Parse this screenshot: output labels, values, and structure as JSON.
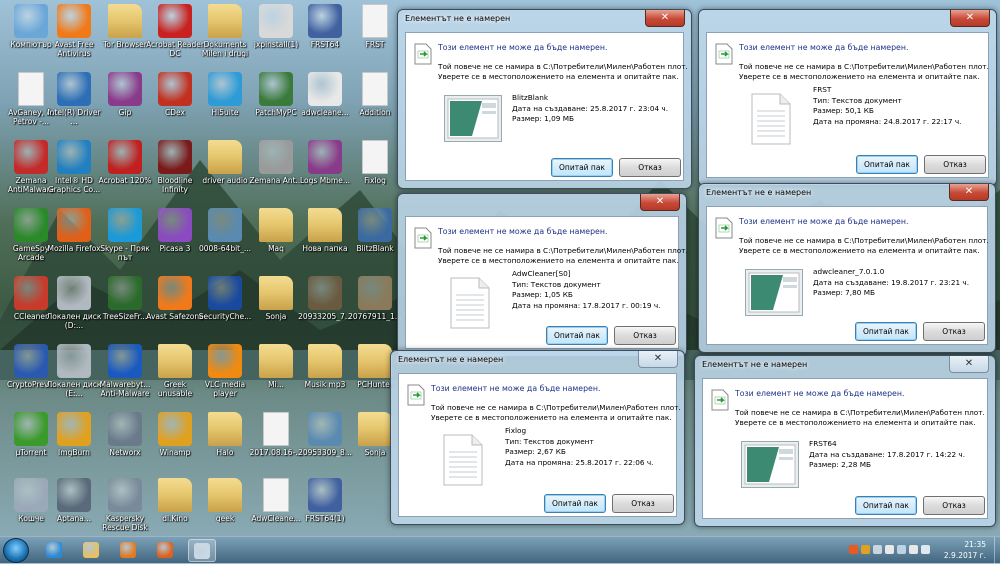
{
  "desktop": {
    "icons": [
      {
        "label": "Компютър",
        "icon": "computer-icon",
        "color": "#6aa7d8"
      },
      {
        "label": "Avast Free Antivirus",
        "icon": "avast-icon",
        "color": "#f07a1a"
      },
      {
        "label": "Tor Browser",
        "icon": "folder-icon",
        "color": "#e7c870"
      },
      {
        "label": "Acrobat Reader DC",
        "icon": "acrobat-icon",
        "color": "#c8211f"
      },
      {
        "label": "Dokuments Milen i drugi",
        "icon": "folder-icon",
        "color": "#e7c870"
      },
      {
        "label": "jxpinstall(1)",
        "icon": "java-installer-icon",
        "color": "#d9d9d9"
      },
      {
        "label": "FRST64",
        "icon": "frst-icon",
        "color": "#4060a0"
      },
      {
        "label": "FRST",
        "icon": "document-icon",
        "color": "#f4f4f4"
      },
      {
        "label": "AvGaney, A. Petrov -...",
        "icon": "document-icon",
        "color": "#f4f4f4"
      },
      {
        "label": "Intel(R) Driver ...",
        "icon": "intel-icon",
        "color": "#2d6fb6"
      },
      {
        "label": "Gip",
        "icon": "winrar-icon",
        "color": "#8a3a8a"
      },
      {
        "label": "CDex",
        "icon": "cdex-icon",
        "color": "#c23020"
      },
      {
        "label": "Hi5uite",
        "icon": "hisuite-icon",
        "color": "#2d9bd6"
      },
      {
        "label": "PatchMyPC",
        "icon": "patchmypc-icon",
        "color": "#3a7a3a"
      },
      {
        "label": "adwcleane...",
        "icon": "adwcleaner-icon",
        "color": "#e8e8e8"
      },
      {
        "label": "Addition",
        "icon": "document-icon",
        "color": "#f4f4f4"
      },
      {
        "label": "Zemana AntiMalware",
        "icon": "zemana-icon",
        "color": "#c42a2a"
      },
      {
        "label": "Intel® HD Graphics Co...",
        "icon": "intel-graphics-icon",
        "color": "#2280c0"
      },
      {
        "label": "Acrobat 120%",
        "icon": "alcohol-icon",
        "color": "#c02020"
      },
      {
        "label": "Bloodline Infinity",
        "icon": "game-icon",
        "color": "#7a1a1a"
      },
      {
        "label": "driver audio",
        "icon": "folder-icon",
        "color": "#e7c870"
      },
      {
        "label": "Zemana Ant...",
        "icon": "setup-icon",
        "color": "#9a9a9a"
      },
      {
        "label": "Logs Mbme...",
        "icon": "winrar-icon",
        "color": "#8a3a8a"
      },
      {
        "label": "Fixlog",
        "icon": "document-icon",
        "color": "#f4f4f4"
      },
      {
        "label": "GameSpy Arcade",
        "icon": "gamespy-icon",
        "color": "#2a8a2a"
      },
      {
        "label": "Mozilla Firefox",
        "icon": "firefox-icon",
        "color": "#e0601a"
      },
      {
        "label": "Skype - Пряк път",
        "icon": "skype-icon",
        "color": "#1a9ad8"
      },
      {
        "label": "Picasa 3",
        "icon": "picasa-icon",
        "color": "#8a4ac0"
      },
      {
        "label": "0008-64bit_...",
        "icon": "disk-image-icon",
        "color": "#5a8ab0"
      },
      {
        "label": "Maq",
        "icon": "folder-icon",
        "color": "#e7c870"
      },
      {
        "label": "Нова папка",
        "icon": "folder-icon",
        "color": "#e7c870"
      },
      {
        "label": "BlitzBlank",
        "icon": "blitzblank-icon",
        "color": "#3a6aa0"
      },
      {
        "label": "CCleaner",
        "icon": "ccleaner-icon",
        "color": "#c83a2a"
      },
      {
        "label": "Локален диск (D:...",
        "icon": "drive-icon",
        "color": "#b0b8c0"
      },
      {
        "label": "TreeSizeFr...",
        "icon": "treesize-icon",
        "color": "#2a6a2a"
      },
      {
        "label": "Avast Safezone",
        "icon": "avast-safezone-icon",
        "color": "#f07a1a"
      },
      {
        "label": "SecurityChe...",
        "icon": "securitycheck-icon",
        "color": "#1a4aa0"
      },
      {
        "label": "Sonja",
        "icon": "folder-icon",
        "color": "#e7c870"
      },
      {
        "label": "20933205_7...",
        "icon": "image-icon",
        "color": "#6a5a40"
      },
      {
        "label": "20767911_1...",
        "icon": "image-icon",
        "color": "#8a7a5a"
      },
      {
        "label": "CryptoPrev...",
        "icon": "cryptoprevent-icon",
        "color": "#2a5ab0"
      },
      {
        "label": "Локален диск (E:...",
        "icon": "drive-icon",
        "color": "#b0b8c0"
      },
      {
        "label": "Malwarebyt... Anti-Malware",
        "icon": "malwarebytes-icon",
        "color": "#1a5ac0"
      },
      {
        "label": "Greek unusable",
        "icon": "folder-icon",
        "color": "#e7c870"
      },
      {
        "label": "VLC media player",
        "icon": "vlc-icon",
        "color": "#f08a10"
      },
      {
        "label": "Mi...",
        "icon": "folder-icon",
        "color": "#e7c870"
      },
      {
        "label": "Musik mp3",
        "icon": "folder-icon",
        "color": "#e7c870"
      },
      {
        "label": "PCHunter",
        "icon": "folder-icon",
        "color": "#e7c870"
      },
      {
        "label": "µTorrent",
        "icon": "utorrent-icon",
        "color": "#3a9a2a"
      },
      {
        "label": "ImgBurn",
        "icon": "imgburn-icon",
        "color": "#e0a020"
      },
      {
        "label": "Networx",
        "icon": "networx-icon",
        "color": "#6a7a8a"
      },
      {
        "label": "Winamp",
        "icon": "winamp-icon",
        "color": "#e0a020"
      },
      {
        "label": "Halo",
        "icon": "folder-icon",
        "color": "#e7c870"
      },
      {
        "label": "2017.08.16-...",
        "icon": "document-icon",
        "color": "#f4f4f4"
      },
      {
        "label": "20953309_8...",
        "icon": "image-icon",
        "color": "#5a8ab0"
      },
      {
        "label": "Sonja",
        "icon": "folder-icon",
        "color": "#e7c870"
      },
      {
        "label": "Кошче",
        "icon": "recycle-bin-icon",
        "color": "#9aa8b8"
      },
      {
        "label": "Aptana...",
        "icon": "setup-icon",
        "color": "#5a6a7a"
      },
      {
        "label": "Kaspersky Rescue Disk",
        "icon": "setup-icon",
        "color": "#7a8a9a"
      },
      {
        "label": "dl.Kino",
        "icon": "folder-icon",
        "color": "#e7c870"
      },
      {
        "label": "geek",
        "icon": "folder-icon",
        "color": "#e7c870"
      },
      {
        "label": "AdwCleane...",
        "icon": "document-icon",
        "color": "#f4f4f4"
      },
      {
        "label": "FRST64(1)",
        "icon": "frst-icon",
        "color": "#4060a0"
      }
    ]
  },
  "dialogs": [
    {
      "title": "Елементът не е намерен",
      "close_glyph": "✕",
      "message_heading": "Този елемент не може да бъде намерен.",
      "message_line1": "Той повече не се намира в C:\\Потребители\\Милен\\Работен плот.",
      "message_line2": "Уверете се в местоположението на елемента и опитайте пак.",
      "file_lines": [
        "BlitzBlank",
        "Дата на създаване: 25.8.2017 г. 23:04 ч.",
        "Размер: 1,09 МБ"
      ],
      "file_icon": "program-icon",
      "retry_label": "Опитай пак",
      "cancel_label": "Отказ"
    },
    {
      "title": "",
      "close_glyph": "✕",
      "message_heading": "Този елемент не може да бъде намерен.",
      "message_line1": "Той повече не се намира в C:\\Потребители\\Милен\\Работен плот.",
      "message_line2": "Уверете се в местоположението на елемента и опитайте пак.",
      "file_lines": [
        "FRST",
        "Тип: Текстов документ",
        "Размер: 50,1 КБ",
        "Дата на промяна: 24.8.2017 г. 22:17 ч."
      ],
      "file_icon": "text-document-icon",
      "retry_label": "Опитай пак",
      "cancel_label": "Отказ"
    },
    {
      "title": "",
      "close_glyph": "✕",
      "message_heading": "Този елемент не може да бъде намерен.",
      "message_line1": "Той повече не се намира в C:\\Потребители\\Милен\\Работен плот.",
      "message_line2": "Уверете се в местоположението на елемента и опитайте пак.",
      "file_lines": [
        "AdwCleaner[S0]",
        "Тип: Текстов документ",
        "Размер: 1,05 КБ",
        "Дата на промяна: 17.8.2017 г. 00:19 ч."
      ],
      "file_icon": "text-document-icon",
      "retry_label": "Опитай пак",
      "cancel_label": "Отказ"
    },
    {
      "title": "Елементът не е намерен",
      "close_glyph": "✕",
      "message_heading": "Този елемент не може да бъде намерен.",
      "message_line1": "Той повече не се намира в C:\\Потребители\\Милен\\Работен плот.",
      "message_line2": "Уверете се в местоположението на елемента и опитайте пак.",
      "file_lines": [
        "adwcleaner_7.0.1.0",
        "Дата на създаване: 19.8.2017 г. 23:21 ч.",
        "Размер: 7,80 МБ"
      ],
      "file_icon": "program-icon",
      "retry_label": "Опитай пак",
      "cancel_label": "Отказ"
    },
    {
      "title": "Елементът не е намерен",
      "close_glyph": "✕",
      "message_heading": "Този елемент не може да бъде намерен.",
      "message_line1": "Той повече не се намира в C:\\Потребители\\Милен\\Работен плот.",
      "message_line2": "Уверете се в местоположението на елемента и опитайте пак.",
      "file_lines": [
        "Fixlog",
        "Тип: Текстов документ",
        "Размер: 2,67 КБ",
        "Дата на промяна: 25.8.2017 г. 22:06 ч."
      ],
      "file_icon": "text-document-icon",
      "retry_label": "Опитай пак",
      "cancel_label": "Отказ"
    },
    {
      "title": "Елементът не е намерен",
      "close_glyph": "✕",
      "message_heading": "Този елемент не може да бъде намерен.",
      "message_line1": "Той повече не се намира в C:\\Потребители\\Милен\\Работен плот.",
      "message_line2": "Уверете се в местоположението на елемента и опитайте пак.",
      "file_lines": [
        "FRST64",
        "Дата на създаване: 17.8.2017 г. 14:22 ч.",
        "Размер: 2,28 МБ"
      ],
      "file_icon": "program-icon",
      "retry_label": "Опитай пак",
      "cancel_label": "Отказ"
    }
  ],
  "taskbar": {
    "pinned": [
      {
        "icon": "internet-explorer-icon",
        "color": "#2a8ad8"
      },
      {
        "icon": "file-explorer-icon",
        "color": "#e8c060"
      },
      {
        "icon": "media-player-icon",
        "color": "#e07a20"
      },
      {
        "icon": "firefox-icon",
        "color": "#e0601a"
      },
      {
        "icon": "active-window-icon",
        "color": "#c8d8e8"
      }
    ],
    "clock_time": "21:35",
    "clock_date": "2.9.2017 г.",
    "tray_icons": [
      "show-hidden-icons-icon",
      "action-center-icon",
      "network-icon",
      "volume-icon",
      "language-icon",
      "update-icon",
      "antivirus-icon"
    ]
  },
  "colors": {
    "close_button": "#c74a37",
    "message_heading": "#1e3287",
    "default_button_border": "#3c7fb1"
  }
}
